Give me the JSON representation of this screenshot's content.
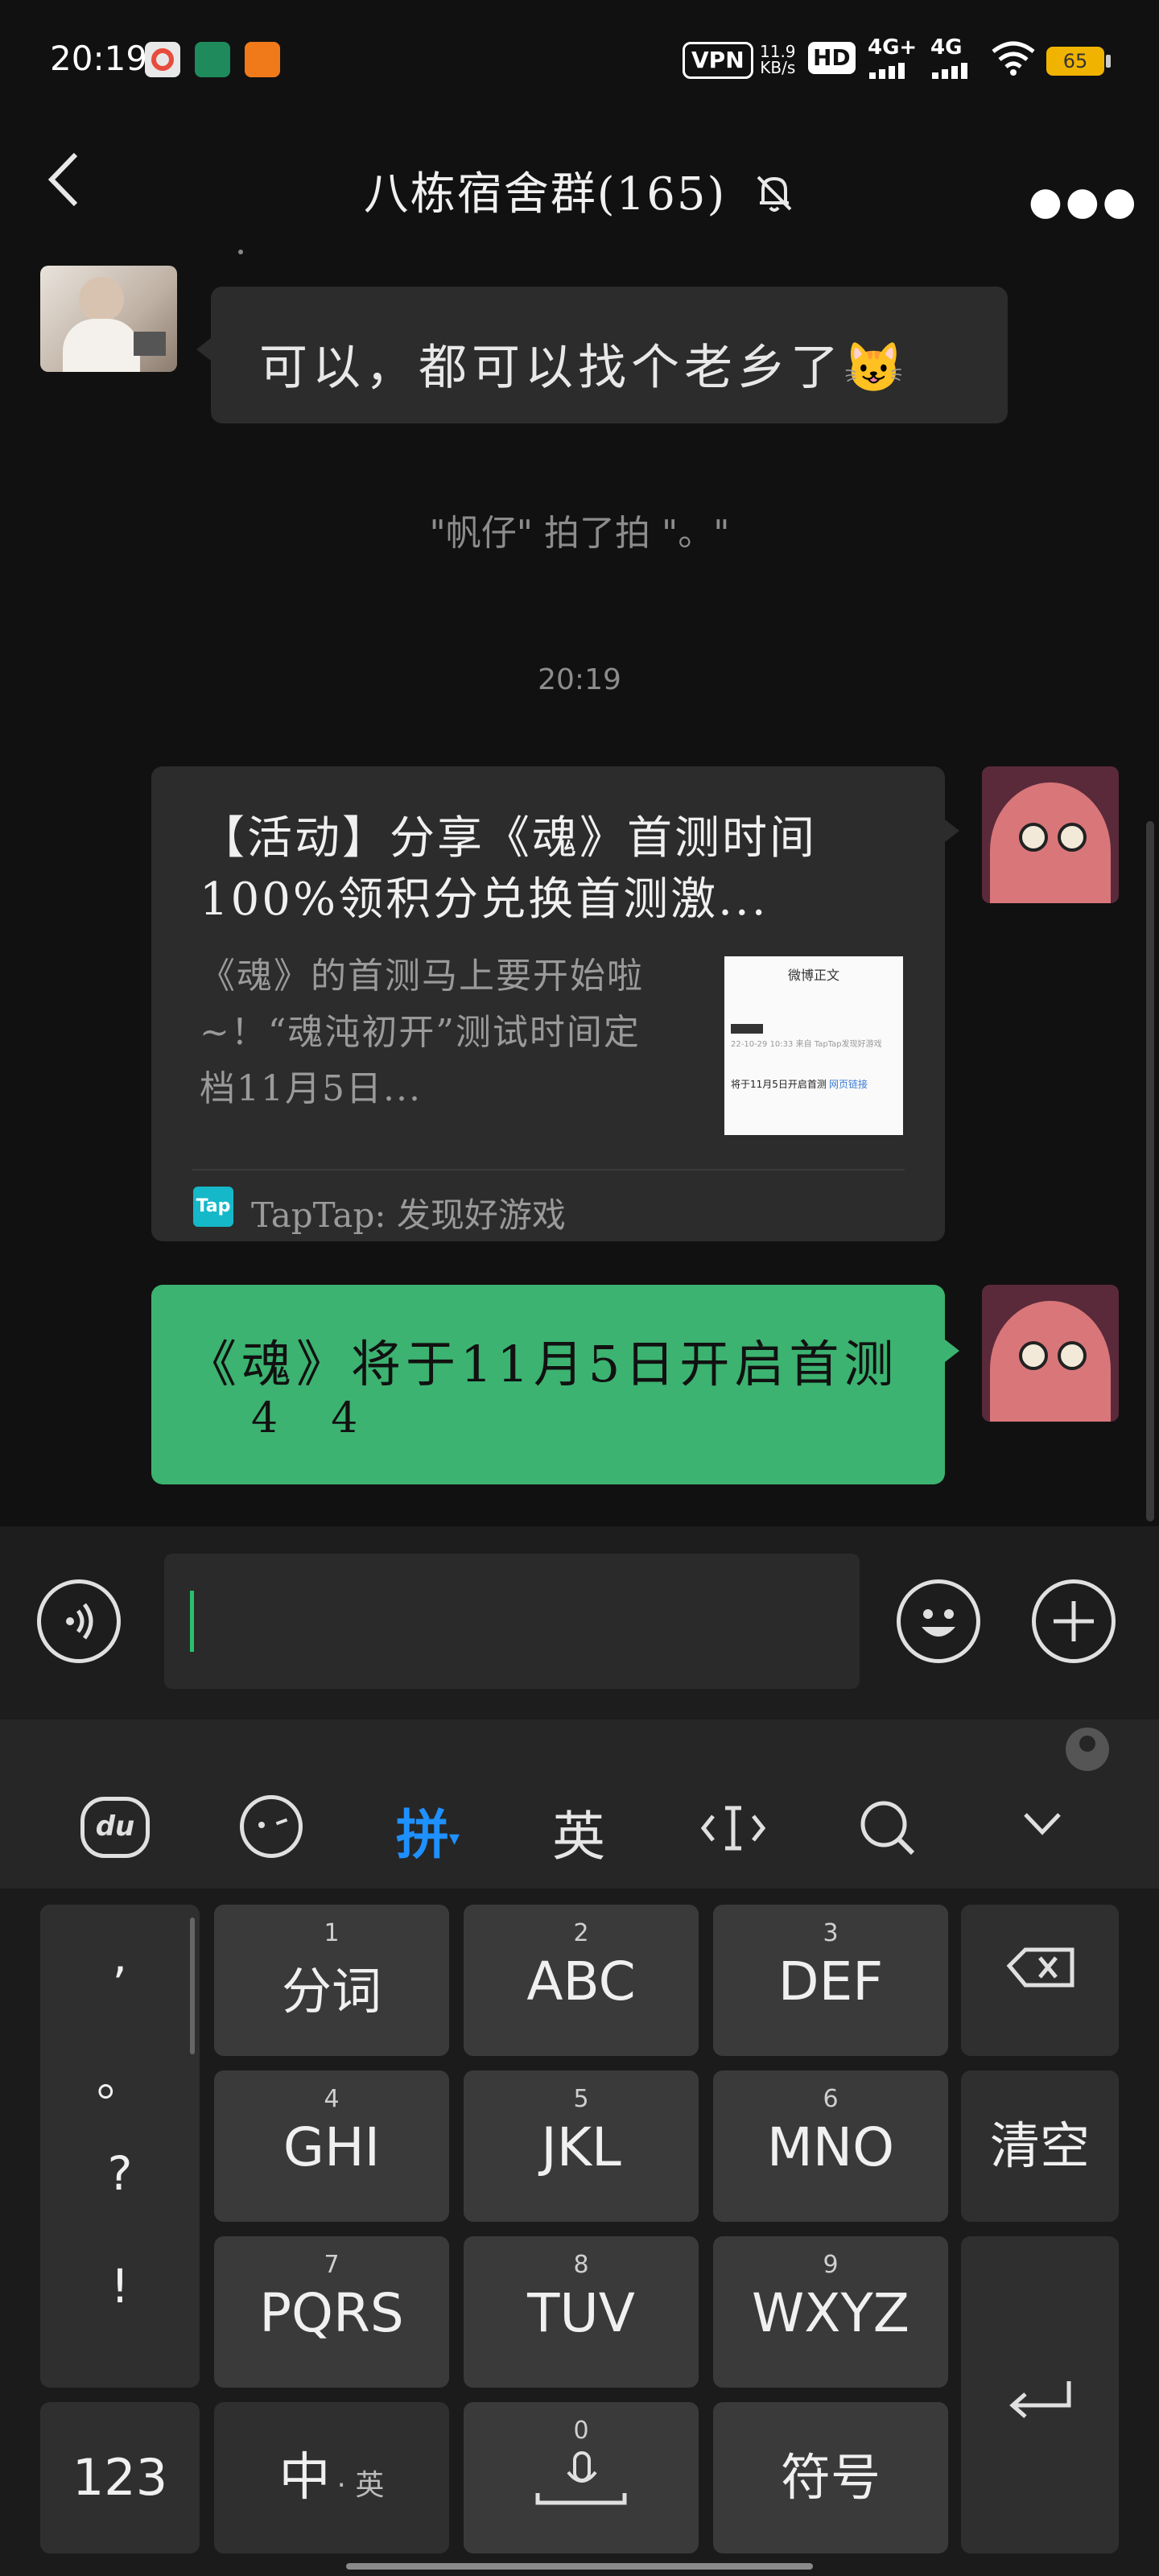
{
  "status_bar": {
    "time": "20:19",
    "vpn": "VPN",
    "speed_top": "11.9",
    "speed_bottom": "KB/s",
    "hd": "HD",
    "net1": "4G+",
    "net2": "4G",
    "battery": "65"
  },
  "header": {
    "title": "八栋宿舍群(165)"
  },
  "messages": {
    "top_text": "可以，都可以找个老乡了😺",
    "system_pat": "\"帆仔\" 拍了拍 \"。\"",
    "timestamp": "20:19",
    "link_card": {
      "title": "【活动】分享《魂》首测时间100%领积分兑换首测激...",
      "desc": "《魂》的首测马上要开始啦~！“魂沌初开”测试时间定档11月5日...",
      "thumb_header": "微博正文",
      "thumb_line1": "22-10-29 10:33 来自 TapTap发现好游戏",
      "thumb_line2": "将于11月5日开启首测",
      "thumb_link": "网页链接",
      "source_logo": "Tap",
      "source": "TapTap: 发现好游戏"
    },
    "green_text_line1": "《魂》将于11月5日开启首测",
    "green_text_line2": "4    4"
  },
  "keyboard_toolbar": {
    "pinyin": "拼",
    "english": "英"
  },
  "keyboard": {
    "punct": [
      ",",
      "。",
      "?",
      "!"
    ],
    "row1": [
      {
        "num": "1",
        "label": "分词"
      },
      {
        "num": "2",
        "label": "ABC"
      },
      {
        "num": "3",
        "label": "DEF"
      }
    ],
    "row2": [
      {
        "num": "4",
        "label": "GHI"
      },
      {
        "num": "5",
        "label": "JKL"
      },
      {
        "num": "6",
        "label": "MNO"
      }
    ],
    "row3": [
      {
        "num": "7",
        "label": "PQRS"
      },
      {
        "num": "8",
        "label": "TUV"
      },
      {
        "num": "9",
        "label": "WXYZ"
      }
    ],
    "clear": "清空",
    "k123": "123",
    "zh": "中",
    "zh_sub": "· 英",
    "space_num": "0",
    "symbols": "符号"
  },
  "colors": {
    "accent_green": "#3cb371",
    "pinyin_blue": "#1e90ff",
    "bg": "#111111"
  }
}
